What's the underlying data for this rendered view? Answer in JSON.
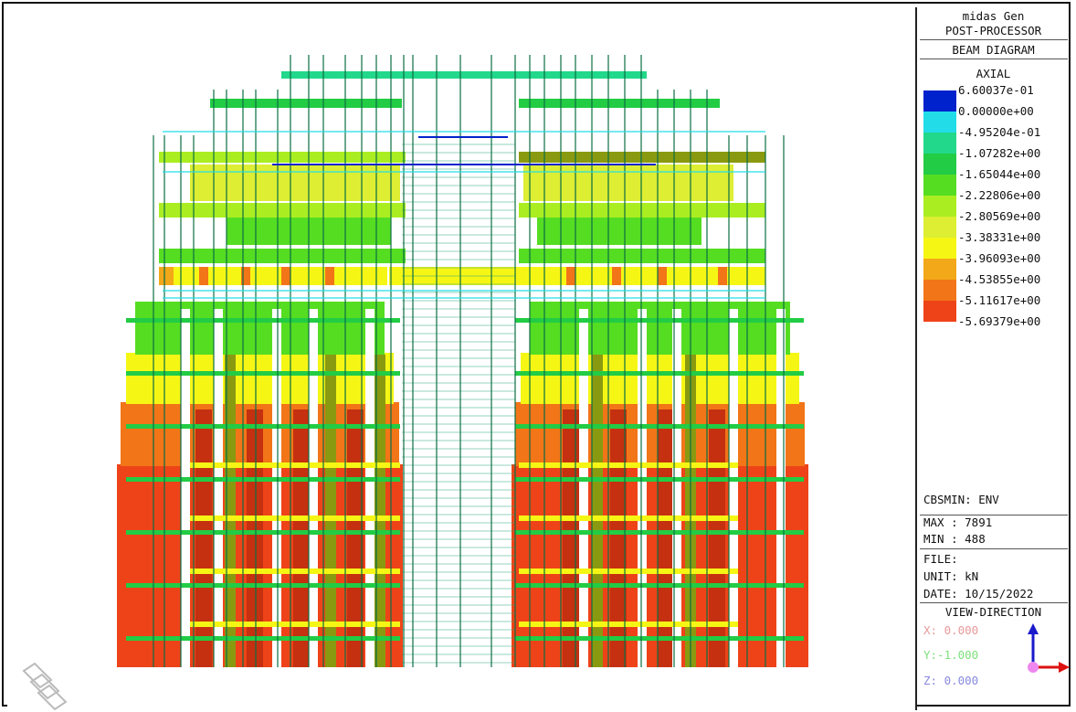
{
  "panel": {
    "program": "midas Gen",
    "module": "POST-PROCESSOR",
    "diagram": "BEAM DIAGRAM",
    "component": "AXIAL"
  },
  "legend": [
    {
      "label": "6.60037e-01",
      "color": "#0022cc"
    },
    {
      "label": "0.00000e+00",
      "color": "#22dde8"
    },
    {
      "label": "-4.95204e-01",
      "color": "#22d88a"
    },
    {
      "label": "-1.07282e+00",
      "color": "#22cc44"
    },
    {
      "label": "-1.65044e+00",
      "color": "#55dd22"
    },
    {
      "label": "-2.22806e+00",
      "color": "#aaee22"
    },
    {
      "label": "-2.80569e+00",
      "color": "#ddee33"
    },
    {
      "label": "-3.38331e+00",
      "color": "#f6f615"
    },
    {
      "label": "-3.96093e+00",
      "color": "#f2a818"
    },
    {
      "label": "-4.53855e+00",
      "color": "#f27518"
    },
    {
      "label": "-5.11617e+00",
      "color": "#ee4318"
    }
  ],
  "legend_last_label": "-5.69379e+00",
  "load": "CBSMIN: ENV",
  "max": "MAX : 7891",
  "min": "MIN : 488",
  "file": "FILE:",
  "unit": "UNIT: kN",
  "date": "DATE: 10/15/2022",
  "view_direction": "VIEW-DIRECTION",
  "view_x": "X: 0.000",
  "view_y": "Y:-1.000",
  "view_z": "Z: 0.000",
  "colors": {
    "view_x": "#e89a9a",
    "view_y": "#7ee07e",
    "view_z": "#8a8ae0",
    "axis_up": "#1a1acc",
    "axis_right": "#dd1111",
    "axis_origin": "#ee88ee"
  },
  "icons": {
    "axis": "axis-triad-icon",
    "logo": "layer-stack-icon"
  }
}
